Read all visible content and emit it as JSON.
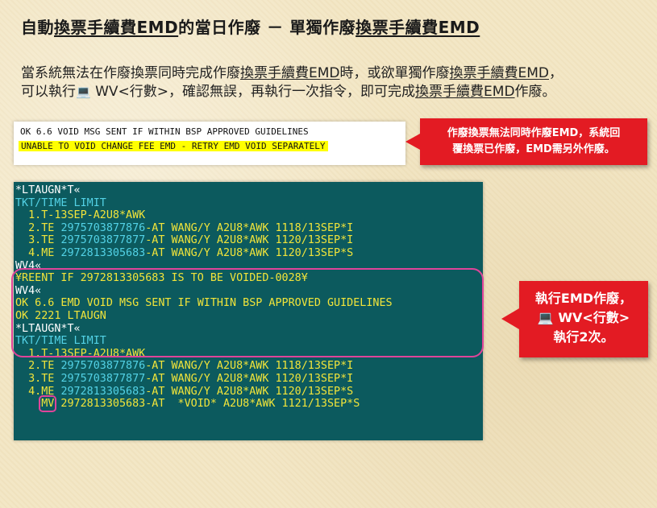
{
  "title": {
    "p1": "自動",
    "p2": "換票手續費EMD",
    "p3": "的當日作廢 － 單獨作廢",
    "p4": "換票手續費EMD"
  },
  "intro": {
    "l1_a": "當系統無法在作廢換票同時完成作廢",
    "l1_b": "換票手續費EMD",
    "l1_c": "時，或欲單獨作廢",
    "l1_d": "換票手續費EMD",
    "l1_e": "，",
    "l2_a": "可以執行",
    "pc_icon": "💻",
    "l2_b": " WV<行數>，確認無誤，再執行一次指令，即可完成",
    "l2_c": "換票手續費EMD",
    "l2_d": "作廢。"
  },
  "message_box": {
    "line1": "OK 6.6 VOID MSG SENT IF WITHIN BSP APPROVED GUIDELINES",
    "line2": "UNABLE TO VOID CHANGE FEE EMD - RETRY EMD VOID SEPARATELY"
  },
  "callout1": {
    "line1": "作廢換票無法同時作廢EMD，系統回",
    "line2": "覆換票已作廢，EMD需另外作廢。"
  },
  "callout2": {
    "line1": "執行EMD作廢，",
    "line2": "💻 WV<行數>",
    "line3": "執行2次。"
  },
  "terminal": {
    "l01": "*LTAUGN*T«",
    "l02": "TKT/TIME LIMIT",
    "l03": "  1.T-13SEP-A2U8*AWK",
    "l04_a": "  2.TE ",
    "l04_b": "2975703877876",
    "l04_c": "-AT WANG/Y A2U8*AWK 1118/13SEP*I",
    "l05_a": "  3.TE ",
    "l05_b": "2975703877877",
    "l05_c": "-AT WANG/Y A2U8*AWK 1120/13SEP*I",
    "l06_a": "  4.ME ",
    "l06_b": "2972813305683",
    "l06_c": "-AT WANG/Y A2U8*AWK 1120/13SEP*S",
    "l07": "WV4«",
    "l08": "¥REENT IF 2972813305683 IS TO BE VOIDED-0028¥",
    "l09": "WV4«",
    "l10": "OK 6.6 EMD VOID MSG SENT IF WITHIN BSP APPROVED GUIDELINES",
    "l11": "OK 2221 LTAUGN",
    "l12": "*LTAUGN*T«",
    "l13": "TKT/TIME LIMIT",
    "l14": "  1.T-13SEP-A2U8*AWK",
    "l15_a": "  2.TE ",
    "l15_b": "2975703877876",
    "l15_c": "-AT WANG/Y A2U8*AWK 1118/13SEP*I",
    "l16_a": "  3.TE ",
    "l16_b": "2975703877877",
    "l16_c": "-AT WANG/Y A2U8*AWK 1120/13SEP*I",
    "l17_a": "  4.ME ",
    "l17_b": "2972813305683",
    "l17_c": "-AT WANG/Y A2U8*AWK 1120/13SEP*S",
    "l18_pre": "    ",
    "l18_mv": "MV",
    "l18_rest": " 2972813305683-AT  *VOID* A2U8*AWK 1121/13SEP*S"
  },
  "colors": {
    "terminal_bg": "#0c5a5e",
    "terminal_cyan": "#53d2e6",
    "terminal_yellow": "#f1e43a",
    "callout_red": "#e31b23",
    "frame_pink": "#e0449a",
    "highlight_yellow": "#ffff00"
  }
}
